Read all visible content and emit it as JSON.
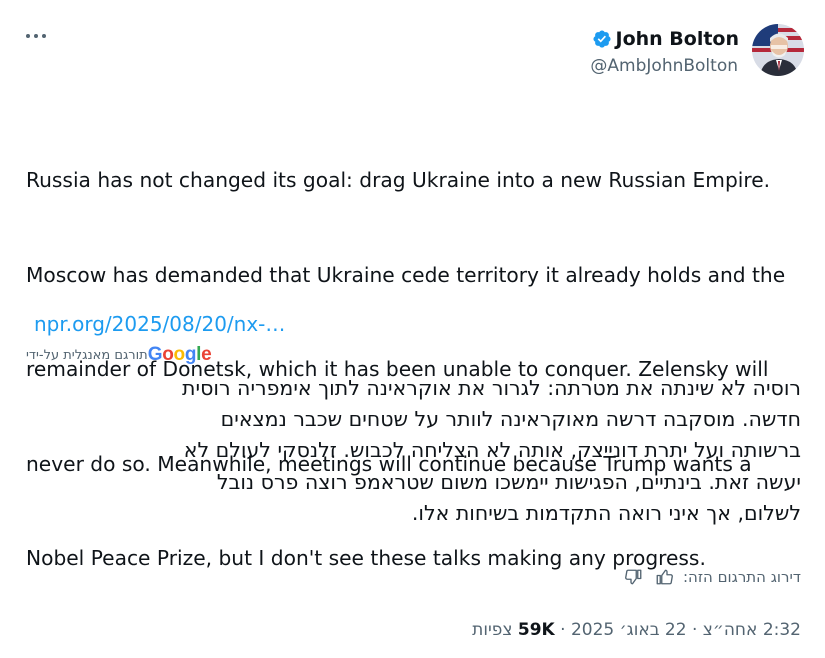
{
  "author": {
    "display_name": "John Bolton",
    "handle": "@AmbJohnBolton",
    "verified_icon": "verified-badge-icon"
  },
  "menu": {
    "icon": "more-horizontal-icon"
  },
  "tweet": {
    "lines": [
      "Russia has not changed its goal: drag Ukraine into a new Russian Empire.",
      "Moscow has demanded that Ukraine cede territory it already holds and the",
      "remainder of Donetsk, which it has been unable to conquer.  Zelensky will",
      "never do so.  Meanwhile, meetings will continue because Trump wants a",
      "Nobel Peace Prize, but I don't see these talks making any progress."
    ],
    "link": "npr.org/2025/08/20/nx-…"
  },
  "translation": {
    "by_label": "תורגם מאנגלית על-ידי",
    "google": [
      "G",
      "o",
      "o",
      "g",
      "l",
      "e"
    ],
    "google_colors": [
      "#4285F4",
      "#EA4335",
      "#FBBC05",
      "#4285F4",
      "#34A853",
      "#EA4335"
    ],
    "lines": [
      "רוסיה לא שינתה את מטרתה: לגרור את אוקראינה לתוך אימפריה רוסית",
      "חדשה. מוסקבה דרשה מאוקראינה לוותר על שטחים שכבר נמצאים",
      "ברשותה ועל יתרת דונייצק, אותה לא הצליחה לכבוש. זלנסקי לעולם לא",
      "יעשה זאת. בינתיים, הפגישות יימשכו משום שטראמפ רוצה פרס נובל",
      "לשלום, אך איני רואה התקדמות בשיחות אלו."
    ],
    "rate_label": "דירוג התרגום הזה:",
    "rate_icons": [
      "thumbs-up-icon",
      "thumbs-down-icon"
    ]
  },
  "meta": {
    "time": "2:32 אחה״צ",
    "date": "22 באוג׳ 2025",
    "views_count": "59K",
    "views_label": "צפיות",
    "separator": "·"
  },
  "colors": {
    "accent": "#1d9bf0",
    "secondary": "#536471",
    "text": "#0f1419"
  }
}
